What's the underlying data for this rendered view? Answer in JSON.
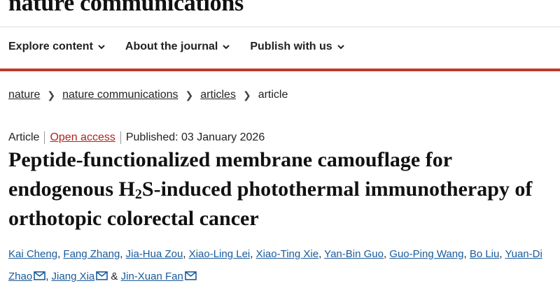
{
  "site": {
    "logo": "nature communications"
  },
  "nav": [
    {
      "label": "Explore content"
    },
    {
      "label": "About the journal"
    },
    {
      "label": "Publish with us"
    }
  ],
  "breadcrumb": [
    "nature",
    "nature communications",
    "articles",
    "article"
  ],
  "meta": {
    "type": "Article",
    "access": "Open access",
    "published": "Published: 03 January 2026"
  },
  "title": {
    "part1": "Peptide-functionalized membrane camouflage for endogenous H",
    "sub": "2",
    "part2": "S-induced photothermal immunotherapy of orthotopic colorectal cancer"
  },
  "authors": [
    "Kai Cheng",
    "Fang Zhang",
    "Jia-Hua Zou",
    "Xiao-Ling Lei",
    "Xiao-Ting Xie",
    "Yan-Bin Guo",
    "Guo-Ping Wang",
    "Bo Liu",
    "Yuan-Di Zhao",
    "Jiang Xia",
    "Jin-Xuan Fan"
  ],
  "colors": {
    "accent_red": "#c0392b",
    "link_blue": "#1a5a9a"
  }
}
